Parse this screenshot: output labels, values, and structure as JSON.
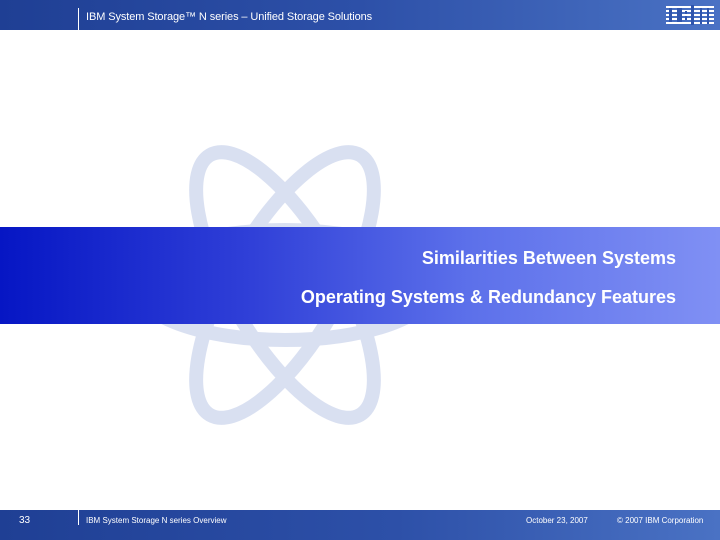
{
  "header": {
    "title": "IBM System Storage™ N series – Unified Storage Solutions",
    "logo": "IBM"
  },
  "section": {
    "title": "Similarities Between Systems",
    "subtitle": "Operating Systems & Redundancy Features"
  },
  "footer": {
    "page_number": "33",
    "deck_title": "IBM System Storage N series Overview",
    "date": "October 23, 2007",
    "copyright": "© 2007 IBM Corporation"
  },
  "colors": {
    "header": "#2d50a8",
    "band_start": "#0616c4",
    "band_end": "#8090f4"
  }
}
